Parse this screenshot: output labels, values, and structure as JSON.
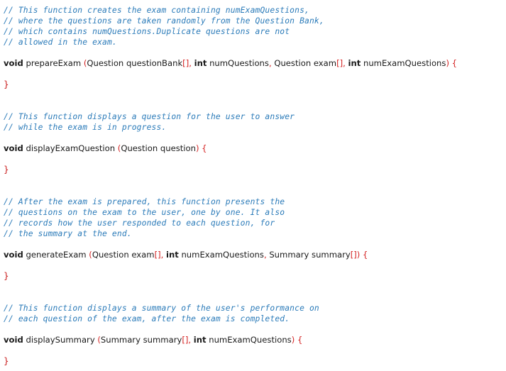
{
  "functions": [
    {
      "comment": [
        "// This function creates the exam containing numExamQuestions,",
        "// where the questions are taken randomly from the Question Bank,",
        "// which contains numQuestions.Duplicate questions are not",
        "// allowed in the exam."
      ],
      "return_type": "void",
      "name": "prepareExam",
      "params": [
        {
          "type": "Question",
          "name": "questionBank",
          "array": "[]"
        },
        {
          "type": "int",
          "name": "numQuestions",
          "array": ""
        },
        {
          "type": "Question",
          "name": "exam",
          "array": "[]"
        },
        {
          "type": "int",
          "name": "numExamQuestions",
          "array": ""
        }
      ]
    },
    {
      "comment": [
        "// This function displays a question for the user to answer",
        "// while the exam is in progress."
      ],
      "return_type": "void",
      "name": "displayExamQuestion",
      "params": [
        {
          "type": "Question",
          "name": "question",
          "array": ""
        }
      ]
    },
    {
      "comment": [
        "// After the exam is prepared, this function presents the",
        "// questions on the exam to the user, one by one. It also",
        "// records how the user responded to each question, for",
        "// the summary at the end."
      ],
      "return_type": "void",
      "name": "generateExam",
      "params": [
        {
          "type": "Question",
          "name": "exam",
          "array": "[]"
        },
        {
          "type": "int",
          "name": "numExamQuestions",
          "array": ""
        },
        {
          "type": "Summary",
          "name": "summary",
          "array": "[]"
        }
      ]
    },
    {
      "comment": [
        "// This function displays a summary of the user's performance on",
        "// each question of the exam, after the exam is completed."
      ],
      "return_type": "void",
      "name": "displaySummary",
      "params": [
        {
          "type": "Summary",
          "name": "summary",
          "array": "[]"
        },
        {
          "type": "int",
          "name": "numExamQuestions",
          "array": ""
        }
      ]
    }
  ],
  "syntax": {
    "open_paren": "(",
    "close_paren": ")",
    "comma": ",",
    "open_brace": "{",
    "close_brace": "}",
    "keywords": [
      "void",
      "int"
    ]
  },
  "colors": {
    "comment": "#2b7bb9",
    "code": "#1a1a1a",
    "punctuation": "#d42020",
    "background": "#ffffff"
  }
}
